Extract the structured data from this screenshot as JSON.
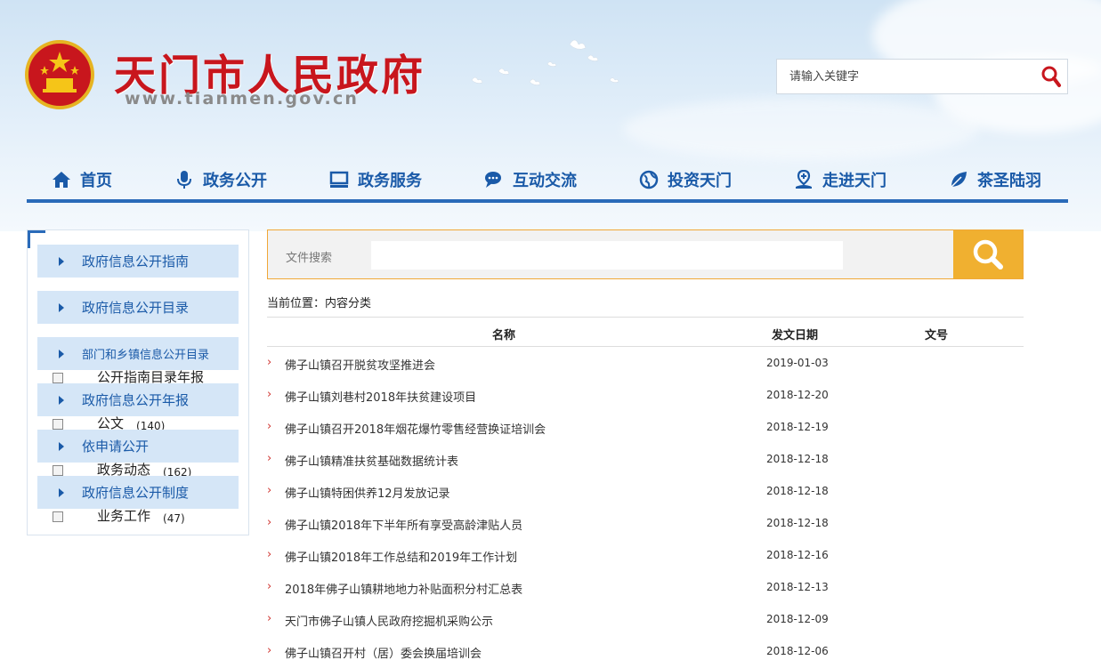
{
  "header": {
    "title": "天门市人民政府",
    "url": "www.tianmen.gov.cn",
    "search_placeholder": "请输入关键字"
  },
  "nav": [
    {
      "label": "首页",
      "icon": "home-icon"
    },
    {
      "label": "政务公开",
      "icon": "microphone-icon"
    },
    {
      "label": "政务服务",
      "icon": "computer-icon"
    },
    {
      "label": "互动交流",
      "icon": "chat-icon"
    },
    {
      "label": "投资天门",
      "icon": "globe-icon"
    },
    {
      "label": "走进天门",
      "icon": "location-icon"
    },
    {
      "label": "茶圣陆羽",
      "icon": "leaf-icon"
    }
  ],
  "sidebar": {
    "items": [
      {
        "label": "政府信息公开指南"
      },
      {
        "label": "政府信息公开目录"
      },
      {
        "label": "部门和乡镇信息公开目录"
      },
      {
        "label": "政府信息公开年报"
      },
      {
        "label": "依申请公开"
      },
      {
        "label": "政府信息公开制度"
      }
    ],
    "subs": [
      {
        "label": "公开指南目录年报",
        "count": ""
      },
      {
        "label": "公文",
        "count": "(140)"
      },
      {
        "label": "政务动态",
        "count": "(162)"
      },
      {
        "label": "业务工作",
        "count": "(47)"
      }
    ]
  },
  "file_search": {
    "label": "文件搜索"
  },
  "breadcrumb": "当前位置：内容分类",
  "table": {
    "headers": {
      "name": "名称",
      "date": "发文日期",
      "docno": "文号"
    },
    "rows": [
      {
        "name": "佛子山镇召开脱贫攻坚推进会",
        "date": "2019-01-03"
      },
      {
        "name": "佛子山镇刘巷村2018年扶贫建设项目",
        "date": "2018-12-20"
      },
      {
        "name": "佛子山镇召开2018年烟花爆竹零售经营换证培训会",
        "date": "2018-12-19"
      },
      {
        "name": "佛子山镇精准扶贫基础数据统计表",
        "date": "2018-12-18"
      },
      {
        "name": "佛子山镇特困供养12月发放记录",
        "date": "2018-12-18"
      },
      {
        "name": "佛子山镇2018年下半年所有享受高龄津贴人员",
        "date": "2018-12-18"
      },
      {
        "name": "佛子山镇2018年工作总结和2019年工作计划",
        "date": "2018-12-16"
      },
      {
        "name": "2018年佛子山镇耕地地力补贴面积分村汇总表",
        "date": "2018-12-13"
      },
      {
        "name": "天门市佛子山镇人民政府挖掘机采购公示",
        "date": "2018-12-09"
      },
      {
        "name": "佛子山镇召开村（居）委会换届培训会",
        "date": "2018-12-06"
      }
    ]
  },
  "colors": {
    "brand_red": "#c8161d",
    "nav_blue": "#1a5aa8",
    "search_orange": "#f0b030"
  }
}
